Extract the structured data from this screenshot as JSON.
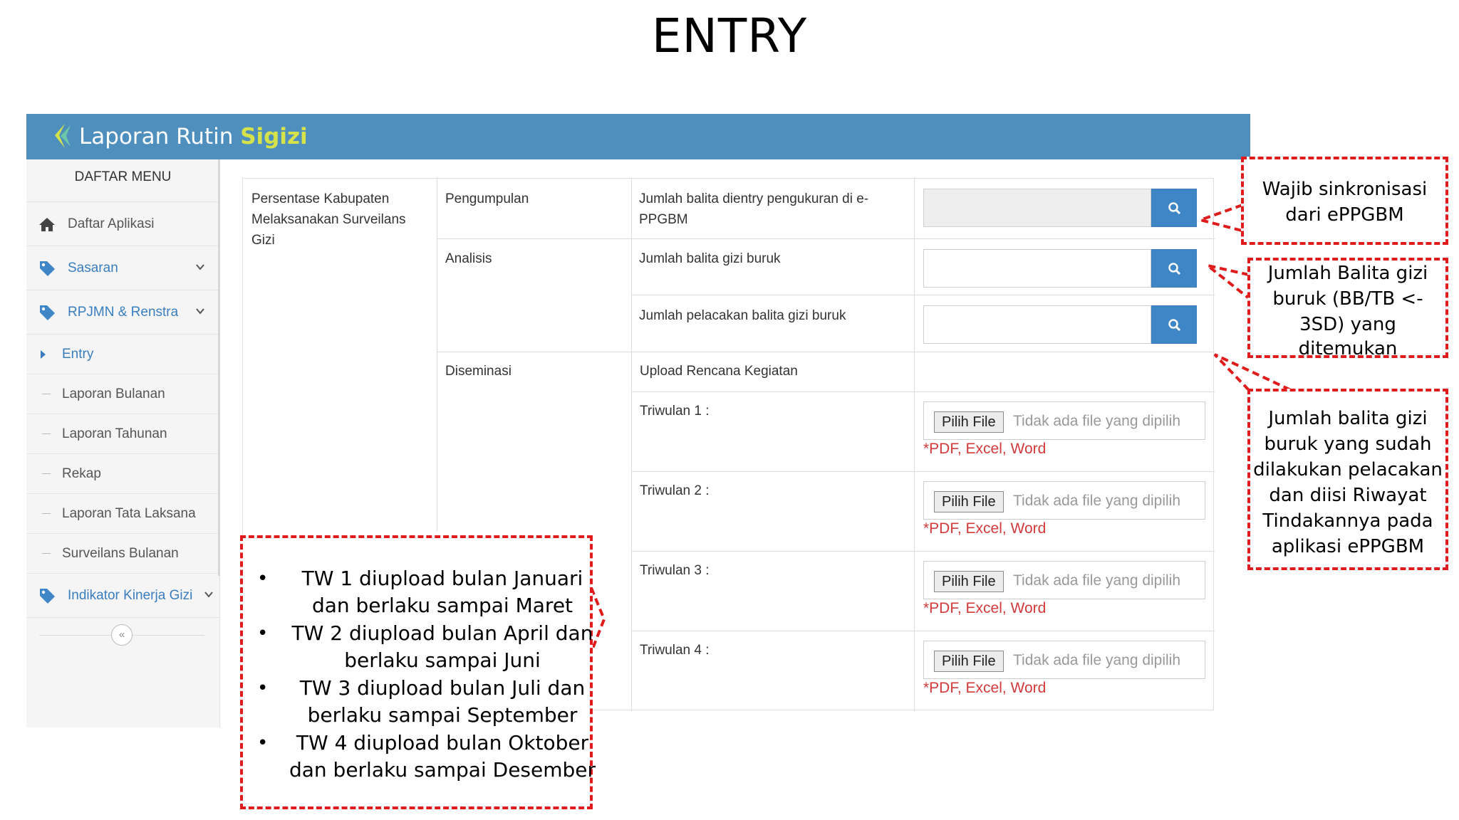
{
  "slide": {
    "title": "ENTRY"
  },
  "header": {
    "app_name_prefix": "Laporan Rutin ",
    "app_name_brand": "Sigizi"
  },
  "sidebar": {
    "heading": "DAFTAR MENU",
    "items": [
      {
        "label": "Daftar Aplikasi",
        "icon": "home-icon"
      },
      {
        "label": "Sasaran",
        "icon": "tag-icon"
      },
      {
        "label": "RPJMN & Renstra",
        "icon": "tag-icon"
      }
    ],
    "subitems": [
      "Entry",
      "Laporan Bulanan",
      "Laporan Tahunan",
      "Rekap",
      "Laporan Tata Laksana",
      "Surveilans Bulanan"
    ],
    "last_item": "Indikator Kinerja Gizi",
    "collapse_symbol": "«"
  },
  "table": {
    "indicator": "Persentase Kabupaten Melaksanakan Surveilans Gizi",
    "stages": [
      "Pengumpulan",
      "Analisis",
      "Diseminasi"
    ],
    "rows": [
      {
        "label": "Jumlah balita dientry pengukuran di e-PPGBM",
        "value": ""
      },
      {
        "label": "Jumlah balita gizi buruk",
        "value": ""
      },
      {
        "label": "Jumlah pelacakan balita gizi buruk",
        "value": ""
      }
    ],
    "upload_heading": "Upload Rencana Kegiatan",
    "uploads": [
      {
        "label": "Triwulan 1 :",
        "button": "Pilih File",
        "status": "Tidak ada file yang dipilih",
        "note": "*PDF, Excel, Word"
      },
      {
        "label": "Triwulan 2 :",
        "button": "Pilih File",
        "status": "Tidak ada file yang dipilih",
        "note": "*PDF, Excel, Word"
      },
      {
        "label": "Triwulan 3 :",
        "button": "Pilih File",
        "status": "Tidak ada file yang dipilih",
        "note": "*PDF, Excel, Word"
      },
      {
        "label": "Triwulan 4 :",
        "button": "Pilih File",
        "status": "Tidak ada file yang dipilih",
        "note": "*PDF, Excel, Word"
      }
    ]
  },
  "callouts": {
    "sync": [
      "Wajib sinkronisasi",
      "dari ePPGBM"
    ],
    "found": [
      "Jumlah Balita gizi",
      "buruk (BB/TB <-",
      "3SD) yang",
      "ditemukan"
    ],
    "tracked": [
      "Jumlah balita gizi",
      "buruk yang sudah",
      "dilakukan pelacakan",
      "dan diisi Riwayat",
      "Tindakannya pada",
      "aplikasi ePPGBM"
    ],
    "bullets": [
      [
        "TW 1 diupload bulan Januari",
        "dan berlaku sampai Maret"
      ],
      [
        "TW 2 diupload bulan April dan",
        "berlaku sampai Juni"
      ],
      [
        "TW 3 diupload bulan Juli dan",
        "berlaku sampai September"
      ],
      [
        "TW 4 diupload bulan Oktober",
        "dan berlaku sampai Desember"
      ]
    ]
  },
  "colors": {
    "header": "#4f8fbe",
    "accent": "#3f86c7",
    "brand": "#d6e24a",
    "callout_border": "#e01b1b",
    "note": "#d13a3a"
  }
}
